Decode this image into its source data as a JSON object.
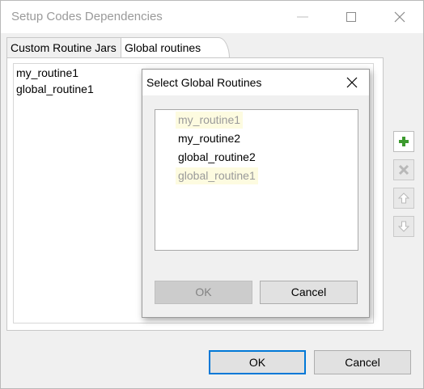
{
  "window": {
    "title": "Setup Codes Dependencies",
    "controls": [
      "minimize-icon",
      "maximize-icon",
      "close-icon"
    ]
  },
  "tabs": [
    {
      "label": "Custom Routine Jars",
      "selected": false
    },
    {
      "label": "Global routines",
      "selected": true
    }
  ],
  "routine_list": {
    "items": [
      "my_routine1",
      "global_routine1"
    ]
  },
  "side_buttons": [
    {
      "icon": "plus-icon",
      "enabled": true,
      "color": "#3c9a2e"
    },
    {
      "icon": "delete-x-icon",
      "enabled": false
    },
    {
      "icon": "arrow-up-icon",
      "enabled": false
    },
    {
      "icon": "arrow-down-icon",
      "enabled": false
    }
  ],
  "footer": {
    "ok_label": "OK",
    "cancel_label": "Cancel",
    "focus_color": "#0078d7"
  },
  "dialog": {
    "title": "Select Global Routines",
    "items": [
      {
        "label": "my_routine1",
        "disabled": true
      },
      {
        "label": "my_routine2",
        "disabled": false
      },
      {
        "label": "global_routine2",
        "disabled": false
      },
      {
        "label": "global_routine1",
        "disabled": true
      }
    ],
    "ok_label": "OK",
    "ok_enabled": false,
    "cancel_label": "Cancel"
  }
}
